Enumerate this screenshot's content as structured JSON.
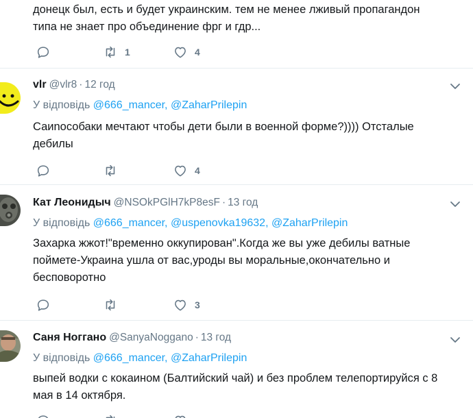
{
  "tweets": [
    {
      "id": "t0",
      "text_lines": [
        "донецк был, есть и будет украинским. тем не менее лживый пропагандон",
        "типа не знает про объединение фрг и гдр..."
      ],
      "retweets": "1",
      "likes": "4"
    },
    {
      "id": "t1",
      "fullname": "vlr",
      "username": "@vlr8",
      "dot": "·",
      "time": "12 год",
      "reply_prefix": "У відповідь",
      "mentions": [
        "@666_mancer,",
        "@ZaharPrilepin"
      ],
      "text_lines": [
        "Саиnособаки мечтают чтобы дети были в военной форме?)))) Отсталые",
        "дебилы"
      ],
      "retweets": "",
      "likes": "4",
      "avatar_icon": "smiley-avatar"
    },
    {
      "id": "t2",
      "fullname": "Кат Леонидыч",
      "username": "@NSOkPGlH7kP8esF",
      "dot": "·",
      "time": "13 год",
      "reply_prefix": "У відповідь",
      "mentions": [
        "@666_mancer,",
        "@uspenovka19632,",
        "@ZaharPrilepin"
      ],
      "text_lines": [
        "Захарка жжот!\"временно оккупирован\".Когда же вы уже дебилы ватные",
        "поймете-Украина ушла от вас,уроды вы моральные,окончательно и",
        "бесповоротно"
      ],
      "retweets": "",
      "likes": "3",
      "avatar_icon": "gasmask-avatar"
    },
    {
      "id": "t3",
      "fullname": "Саня Ноггано",
      "username": "@SanyaNoggano",
      "dot": "·",
      "time": "13 год",
      "reply_prefix": "У відповідь",
      "mentions": [
        "@666_mancer,",
        "@ZaharPrilepin"
      ],
      "text_lines": [
        "выпей водки с кокаином (Балтийский чай) и без проблем телепортируйся с 8",
        "мая в 14 октября."
      ],
      "avatar_icon": "soldier-avatar"
    }
  ],
  "colors": {
    "accent": "#1da1f2",
    "secondary_text": "#657786",
    "primary_text": "#14171a",
    "divider": "#e6ecf0"
  }
}
